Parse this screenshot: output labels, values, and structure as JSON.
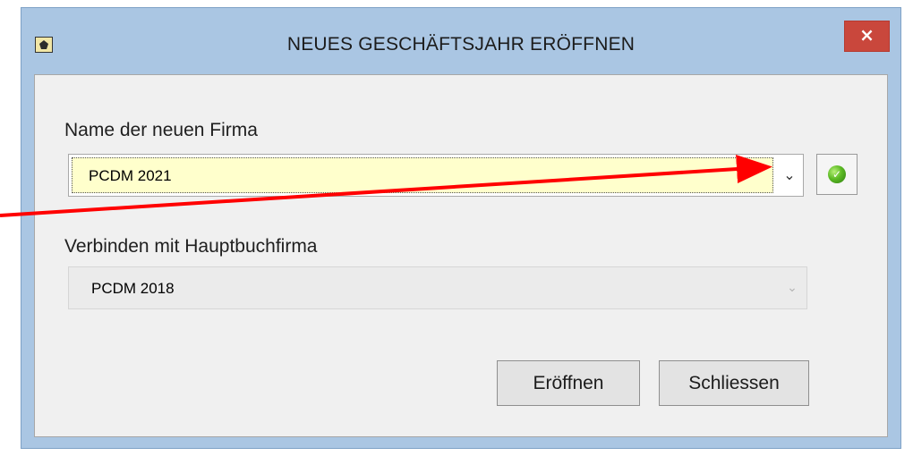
{
  "window": {
    "title": "NEUES GESCHÄFTSJAHR ERÖFFNEN",
    "close_label": "×"
  },
  "form": {
    "firma_label": "Name der neuen Firma",
    "firma_value": "PCDM 2021",
    "firma_dropdown_glyph": "⌄",
    "hauptbuch_label": "Verbinden mit Hauptbuchfirma",
    "hauptbuch_value": "PCDM 2018",
    "hauptbuch_dropdown_glyph": "⌄",
    "confirm_icon": "checkmark-icon"
  },
  "buttons": {
    "open_label": "Eröffnen",
    "close_label": "Schliessen"
  },
  "annotation": {
    "arrow_color": "#ff0000"
  }
}
